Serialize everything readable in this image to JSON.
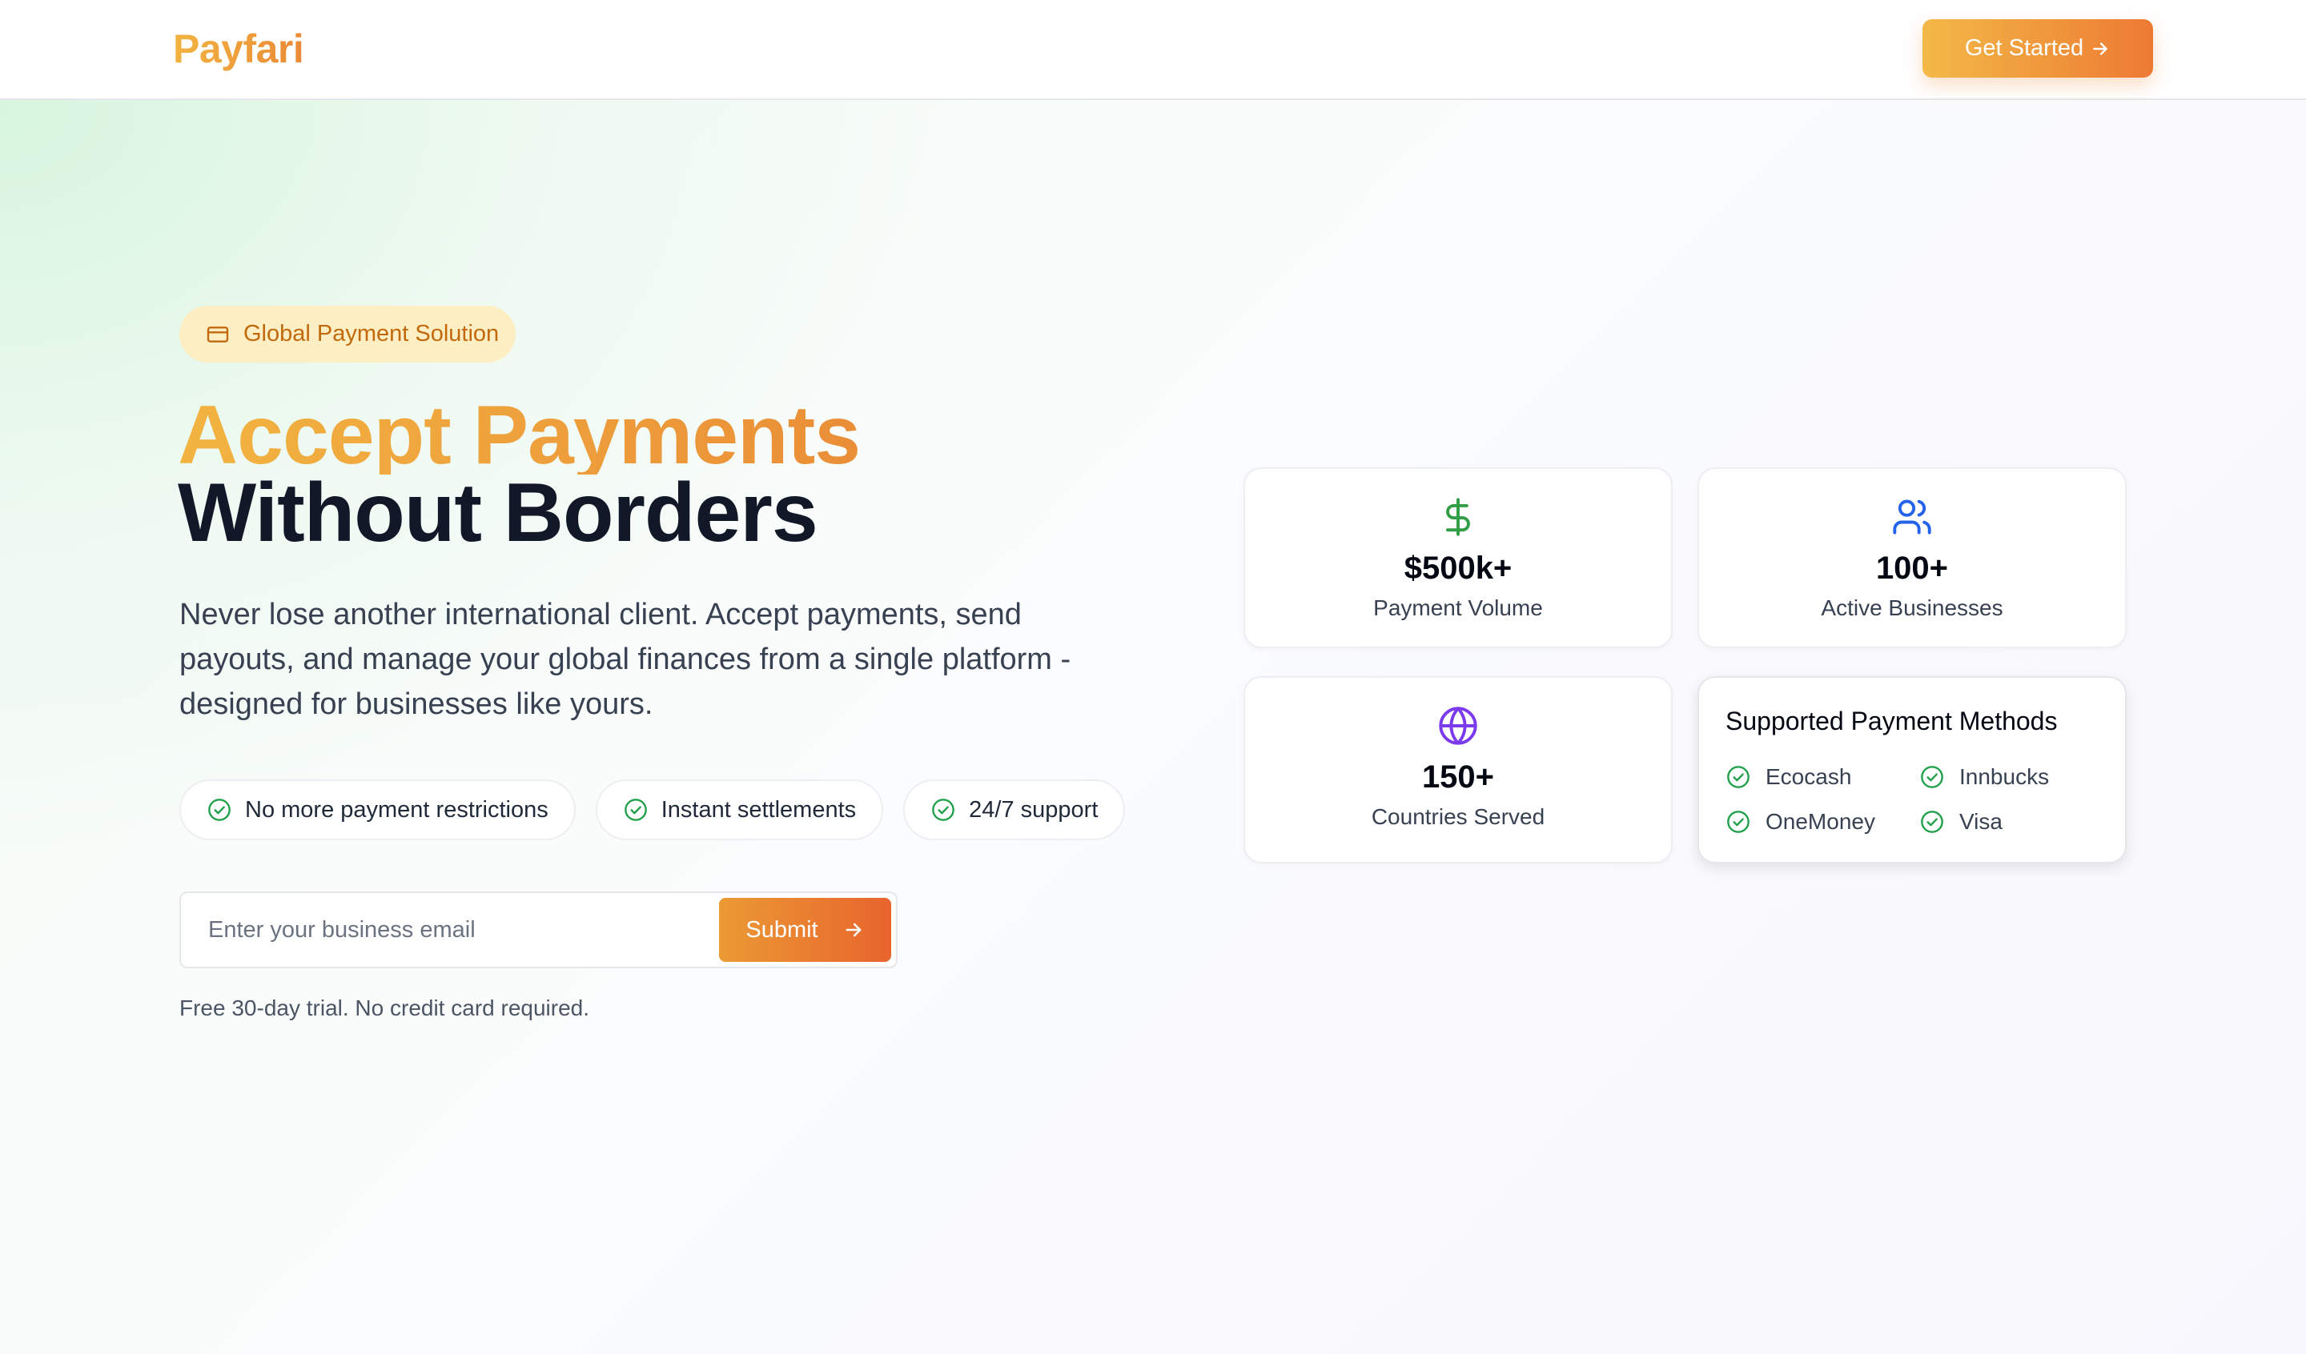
{
  "header": {
    "logo": "Payfari",
    "cta_label": "Get Started"
  },
  "hero": {
    "badge": "Global Payment Solution",
    "headline_line1": "Accept Payments",
    "headline_line2": "Without Borders",
    "description": "Never lose another international client. Accept payments, send payouts, and manage your global finances from a single platform - designed for businesses like yours.",
    "features": [
      "No more payment restrictions",
      "Instant settlements",
      "24/7 support"
    ],
    "email_placeholder": "Enter your business email",
    "submit_label": "Submit",
    "fine_print": "Free 30-day trial. No credit card required."
  },
  "stats": [
    {
      "value": "$500k+",
      "label": "Payment Volume",
      "icon": "dollar-icon",
      "color": "#2f9e44"
    },
    {
      "value": "100+",
      "label": "Active Businesses",
      "icon": "users-icon",
      "color": "#2563eb"
    },
    {
      "value": "150+",
      "label": "Countries Served",
      "icon": "globe-icon",
      "color": "#7c3aed"
    }
  ],
  "payment_methods": {
    "title": "Supported Payment Methods",
    "items": [
      "Ecocash",
      "Innbucks",
      "OneMoney",
      "Visa"
    ]
  },
  "colors": {
    "brand_gradient_start": "#f2b441",
    "brand_gradient_end": "#eb6a2d",
    "check_green": "#22a04b",
    "badge_bg": "#fdefc3",
    "badge_text": "#c2690c"
  }
}
